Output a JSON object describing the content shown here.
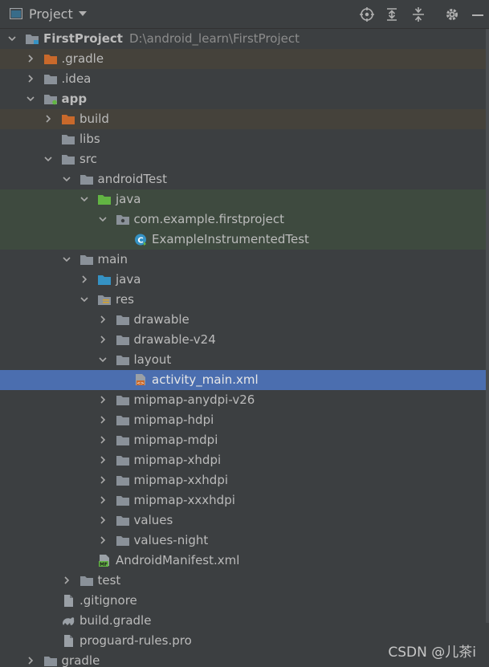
{
  "header": {
    "title": "Project",
    "tools": [
      "locate-icon",
      "expand-all-icon",
      "collapse-all-icon",
      "settings-icon",
      "hide-icon"
    ]
  },
  "tree": [
    {
      "depth": 0,
      "label": "FirstProject",
      "path": "D:\\android_learn\\FirstProject",
      "icon": "module",
      "expanded": true,
      "bold": true,
      "style": ""
    },
    {
      "depth": 1,
      "label": ".gradle",
      "icon": "folder-orange",
      "expanded": false,
      "style": "mod"
    },
    {
      "depth": 1,
      "label": ".idea",
      "icon": "folder",
      "expanded": false,
      "style": ""
    },
    {
      "depth": 1,
      "label": "app",
      "icon": "module-app",
      "expanded": true,
      "bold": true,
      "style": ""
    },
    {
      "depth": 2,
      "label": "build",
      "icon": "folder-orange",
      "expanded": false,
      "style": "mod"
    },
    {
      "depth": 2,
      "label": "libs",
      "icon": "folder",
      "leaf": true,
      "style": ""
    },
    {
      "depth": 2,
      "label": "src",
      "icon": "folder",
      "expanded": true,
      "style": ""
    },
    {
      "depth": 3,
      "label": "androidTest",
      "icon": "folder",
      "expanded": true,
      "style": ""
    },
    {
      "depth": 4,
      "label": "java",
      "icon": "folder-green",
      "expanded": true,
      "style": "test"
    },
    {
      "depth": 5,
      "label": "com.example.firstproject",
      "icon": "package",
      "expanded": true,
      "style": "test"
    },
    {
      "depth": 6,
      "label": "ExampleInstrumentedTest",
      "icon": "class",
      "leaf": true,
      "style": "test"
    },
    {
      "depth": 3,
      "label": "main",
      "icon": "folder",
      "expanded": true,
      "style": ""
    },
    {
      "depth": 4,
      "label": "java",
      "icon": "folder-blue",
      "expanded": false,
      "style": ""
    },
    {
      "depth": 4,
      "label": "res",
      "icon": "folder-res",
      "expanded": true,
      "style": ""
    },
    {
      "depth": 5,
      "label": "drawable",
      "icon": "folder",
      "expanded": false,
      "style": ""
    },
    {
      "depth": 5,
      "label": "drawable-v24",
      "icon": "folder",
      "expanded": false,
      "style": ""
    },
    {
      "depth": 5,
      "label": "layout",
      "icon": "folder",
      "expanded": true,
      "style": ""
    },
    {
      "depth": 6,
      "label": "activity_main.xml",
      "icon": "xml",
      "leaf": true,
      "style": "sel"
    },
    {
      "depth": 5,
      "label": "mipmap-anydpi-v26",
      "icon": "folder",
      "expanded": false,
      "style": ""
    },
    {
      "depth": 5,
      "label": "mipmap-hdpi",
      "icon": "folder",
      "expanded": false,
      "style": ""
    },
    {
      "depth": 5,
      "label": "mipmap-mdpi",
      "icon": "folder",
      "expanded": false,
      "style": ""
    },
    {
      "depth": 5,
      "label": "mipmap-xhdpi",
      "icon": "folder",
      "expanded": false,
      "style": ""
    },
    {
      "depth": 5,
      "label": "mipmap-xxhdpi",
      "icon": "folder",
      "expanded": false,
      "style": ""
    },
    {
      "depth": 5,
      "label": "mipmap-xxxhdpi",
      "icon": "folder",
      "expanded": false,
      "style": ""
    },
    {
      "depth": 5,
      "label": "values",
      "icon": "folder",
      "expanded": false,
      "style": ""
    },
    {
      "depth": 5,
      "label": "values-night",
      "icon": "folder",
      "expanded": false,
      "style": ""
    },
    {
      "depth": 4,
      "label": "AndroidManifest.xml",
      "icon": "manifest",
      "leaf": true,
      "style": ""
    },
    {
      "depth": 3,
      "label": "test",
      "icon": "folder",
      "expanded": false,
      "style": ""
    },
    {
      "depth": 2,
      "label": ".gitignore",
      "icon": "file",
      "leaf": true,
      "style": ""
    },
    {
      "depth": 2,
      "label": "build.gradle",
      "icon": "gradle",
      "leaf": true,
      "style": ""
    },
    {
      "depth": 2,
      "label": "proguard-rules.pro",
      "icon": "file",
      "leaf": true,
      "style": ""
    },
    {
      "depth": 1,
      "label": "gradle",
      "icon": "folder",
      "expanded": false,
      "style": ""
    }
  ],
  "watermark": "CSDN @儿茶i",
  "colors": {
    "folder": "#8a9199",
    "orange": "#c9692b",
    "green": "#62b543",
    "blue": "#3592c4",
    "selection": "#4b6eaf"
  }
}
